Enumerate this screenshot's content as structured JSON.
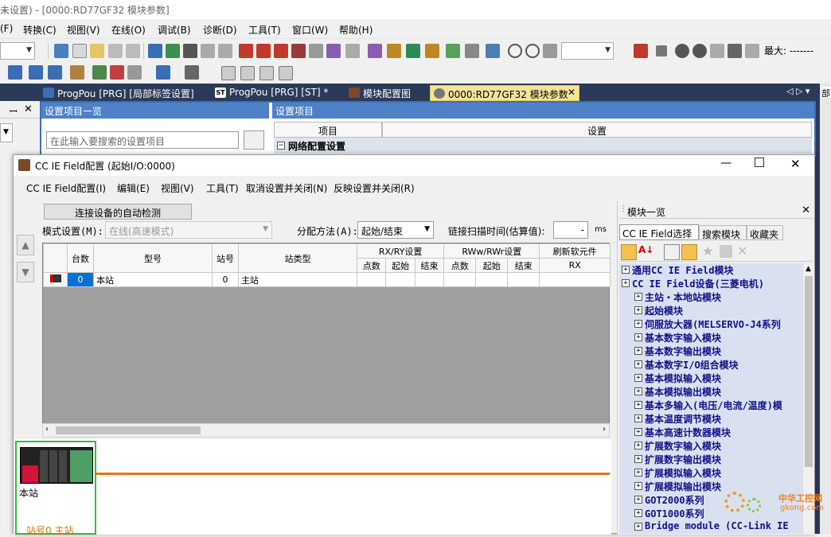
{
  "app_title": "未设置) - [0000:RD77GF32 模块参数]",
  "menubar": [
    "(F)",
    "转换(C)",
    "视图(V)",
    "在线(O)",
    "调试(B)",
    "诊断(D)",
    "工具(T)",
    "窗口(W)",
    "帮助(H)"
  ],
  "toolbar": {
    "max_label": "最大: -------"
  },
  "tabs": [
    {
      "label": "ProgPou [PRG] [局部标签设置]"
    },
    {
      "label": "ProgPou [PRG] [ST] *"
    },
    {
      "label": "模块配置图"
    },
    {
      "label": "0000:RD77GF32 模块参数"
    }
  ],
  "bg_pane": {
    "left_header": "设置项目一览",
    "search_placeholder": "在此输入要搜索的设置项目",
    "right_header": "设置项目",
    "col_item": "项目",
    "col_setting": "设置",
    "group": "网络配置设置"
  },
  "dialog": {
    "title": "CC IE Field配置 (起始I/O:0000)",
    "menu": [
      "CC IE Field配置(I)",
      "编辑(E)",
      "视图(V)",
      "工具(T)",
      "取消设置并关闭(N)",
      "反映设置并关闭(R)"
    ],
    "auto_detect_button": "连接设备的自动检测",
    "mode_label": "模式设置(M):",
    "mode_value": "在线(高速模式)",
    "assign_label": "分配方法(A):",
    "assign_value": "起始/结束",
    "scan_label": "链接扫描时间(估算值):",
    "scan_value": "-",
    "scan_unit": "ms",
    "grid": {
      "headers": [
        "台数",
        "型号",
        "站号",
        "站类型",
        "RX/RY设置",
        "RWw/RWr设置",
        "刷新软元件"
      ],
      "subheaders": [
        "点数",
        "起始",
        "结束",
        "点数",
        "起始",
        "结束",
        "RX"
      ],
      "rows": [
        {
          "count": "0",
          "model": "本站",
          "station": "0",
          "type": "主站"
        }
      ]
    },
    "station_label": "本站",
    "station_footer": "站号0  主站"
  },
  "palette": {
    "title": "模块一览",
    "tabs": [
      "CC IE Field选择",
      "搜索模块",
      "收藏夹"
    ],
    "items": [
      {
        "label": "通用CC IE Field模块",
        "level": 1
      },
      {
        "label": "CC IE Field设备(三菱电机)",
        "level": 1
      },
      {
        "label": "主站・本地站模块",
        "level": 2
      },
      {
        "label": "起始模块",
        "level": 2
      },
      {
        "label": "伺服放大器(MELSERVO-J4系列",
        "level": 2
      },
      {
        "label": "基本数字输入模块",
        "level": 2
      },
      {
        "label": "基本数字输出模块",
        "level": 2
      },
      {
        "label": "基本数字I/O组合模块",
        "level": 2
      },
      {
        "label": "基本模拟输入模块",
        "level": 2
      },
      {
        "label": "基本模拟输出模块",
        "level": 2
      },
      {
        "label": "基本多输入(电压/电流/温度)模",
        "level": 2
      },
      {
        "label": "基本温度调节模块",
        "level": 2
      },
      {
        "label": "基本高速计数器模块",
        "level": 2
      },
      {
        "label": "扩展数字输入模块",
        "level": 2
      },
      {
        "label": "扩展数字输出模块",
        "level": 2
      },
      {
        "label": "扩展模拟输入模块",
        "level": 2
      },
      {
        "label": "扩展模拟输出模块",
        "level": 2
      },
      {
        "label": "GOT2000系列",
        "level": 2
      },
      {
        "label": "GOT1000系列",
        "level": 2
      },
      {
        "label": "Bridge module (CC-Link IE",
        "level": 2
      }
    ]
  },
  "watermark": {
    "cn": "中华工控网",
    "url": "gkong.com"
  }
}
